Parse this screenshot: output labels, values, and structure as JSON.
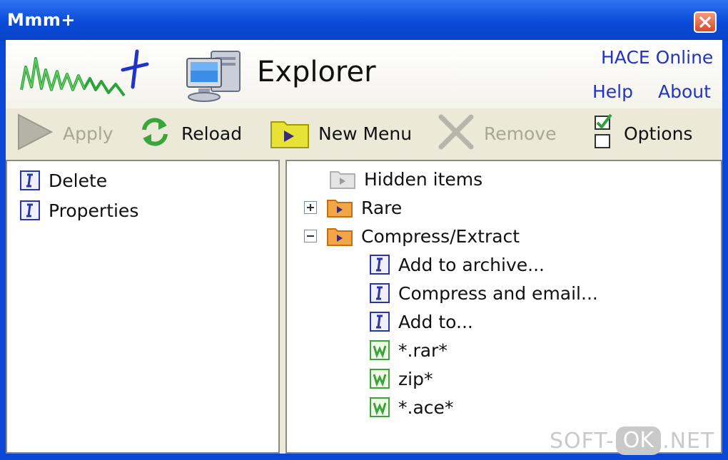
{
  "window": {
    "title": "Mmm+"
  },
  "header": {
    "logo_text": "Mmm+",
    "title": "Explorer",
    "links": {
      "online": "HACE Online",
      "help": "Help",
      "about": "About"
    }
  },
  "toolbar": {
    "apply": {
      "label": "Apply",
      "enabled": false
    },
    "reload": {
      "label": "Reload",
      "enabled": true
    },
    "new_menu": {
      "label": "New Menu",
      "enabled": true
    },
    "remove": {
      "label": "Remove",
      "enabled": false
    },
    "options": {
      "label": "Options",
      "enabled": true
    }
  },
  "left_list": [
    {
      "label": "Delete",
      "icon": "i-icon"
    },
    {
      "label": "Properties",
      "icon": "i-icon"
    }
  ],
  "tree": {
    "hidden": {
      "label": "Hidden items",
      "icon": "gray-folder-icon"
    },
    "rare": {
      "label": "Rare",
      "icon": "orange-folder-icon",
      "expanded": false
    },
    "compress": {
      "label": "Compress/Extract",
      "icon": "orange-folder-icon",
      "expanded": true,
      "children": [
        {
          "label": "Add to archive...",
          "icon": "i-icon"
        },
        {
          "label": "Compress and email...",
          "icon": "i-icon"
        },
        {
          "label": "Add to...",
          "icon": "i-icon"
        },
        {
          "label": "*.rar*",
          "icon": "w-icon"
        },
        {
          "label": "zip*",
          "icon": "w-icon"
        },
        {
          "label": "*.ace*",
          "icon": "w-icon"
        }
      ]
    }
  },
  "watermark": {
    "left": "SOFT-",
    "mid": "OK",
    "right": ".NET"
  },
  "colors": {
    "titlebar": "#0a47d6",
    "link": "#2234c8",
    "folder": "#f0a040",
    "accent_green": "#3aa63a"
  }
}
